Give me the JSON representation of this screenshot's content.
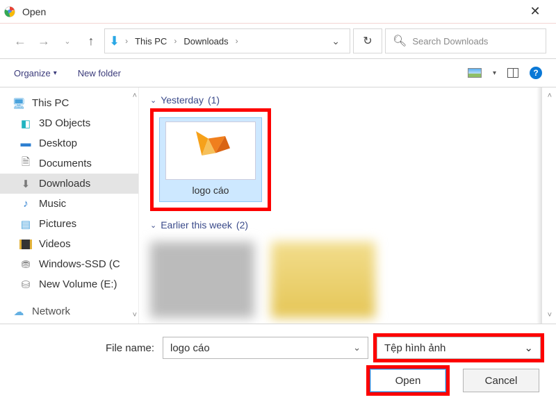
{
  "titlebar": {
    "title": "Open"
  },
  "nav": {
    "breadcrumbs": [
      "This PC",
      "Downloads"
    ],
    "search_placeholder": "Search Downloads"
  },
  "toolbar": {
    "organize": "Organize",
    "new_folder": "New folder"
  },
  "tree": {
    "items": [
      {
        "icon": "monitor-icon",
        "label": "This PC",
        "top": true
      },
      {
        "icon": "cube-icon",
        "label": "3D Objects"
      },
      {
        "icon": "desktop-icon",
        "label": "Desktop"
      },
      {
        "icon": "document-icon",
        "label": "Documents"
      },
      {
        "icon": "download-icon",
        "label": "Downloads",
        "active": true
      },
      {
        "icon": "music-icon",
        "label": "Music"
      },
      {
        "icon": "pictures-icon",
        "label": "Pictures"
      },
      {
        "icon": "videos-icon",
        "label": "Videos"
      },
      {
        "icon": "disk-icon",
        "label": "Windows-SSD (C"
      },
      {
        "icon": "disk-icon",
        "label": "New Volume (E:)"
      },
      {
        "icon": "network-icon",
        "label": "Network",
        "top": true
      }
    ]
  },
  "content": {
    "groups": [
      {
        "label": "Yesterday",
        "count": "(1)"
      },
      {
        "label": "Earlier this week",
        "count": "(2)"
      }
    ],
    "selected_file": {
      "name": "logo cáo"
    }
  },
  "footer": {
    "filename_label": "File name:",
    "filename_value": "logo cáo",
    "filter_label": "Tệp hình ảnh",
    "open": "Open",
    "cancel": "Cancel"
  }
}
